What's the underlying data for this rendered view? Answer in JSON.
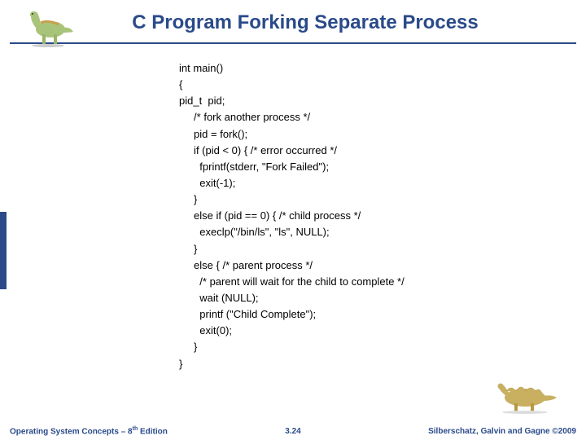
{
  "header": {
    "title": "C Program Forking Separate Process"
  },
  "code_lines": [
    "int main()",
    "{",
    "pid_t  pid;",
    "     /* fork another process */",
    "     pid = fork();",
    "     if (pid < 0) { /* error occurred */",
    "       fprintf(stderr, \"Fork Failed\");",
    "       exit(-1);",
    "     }",
    "     else if (pid == 0) { /* child process */",
    "       execlp(\"/bin/ls\", \"ls\", NULL);",
    "     }",
    "     else { /* parent process */",
    "       /* parent will wait for the child to complete */",
    "       wait (NULL);",
    "       printf (\"Child Complete\");",
    "       exit(0);",
    "     }",
    "}"
  ],
  "footer": {
    "left_prefix": "Operating System Concepts – 8",
    "left_sup": "th",
    "left_suffix": " Edition",
    "center": "3.24",
    "right": "Silberschatz, Galvin and Gagne ©2009"
  }
}
